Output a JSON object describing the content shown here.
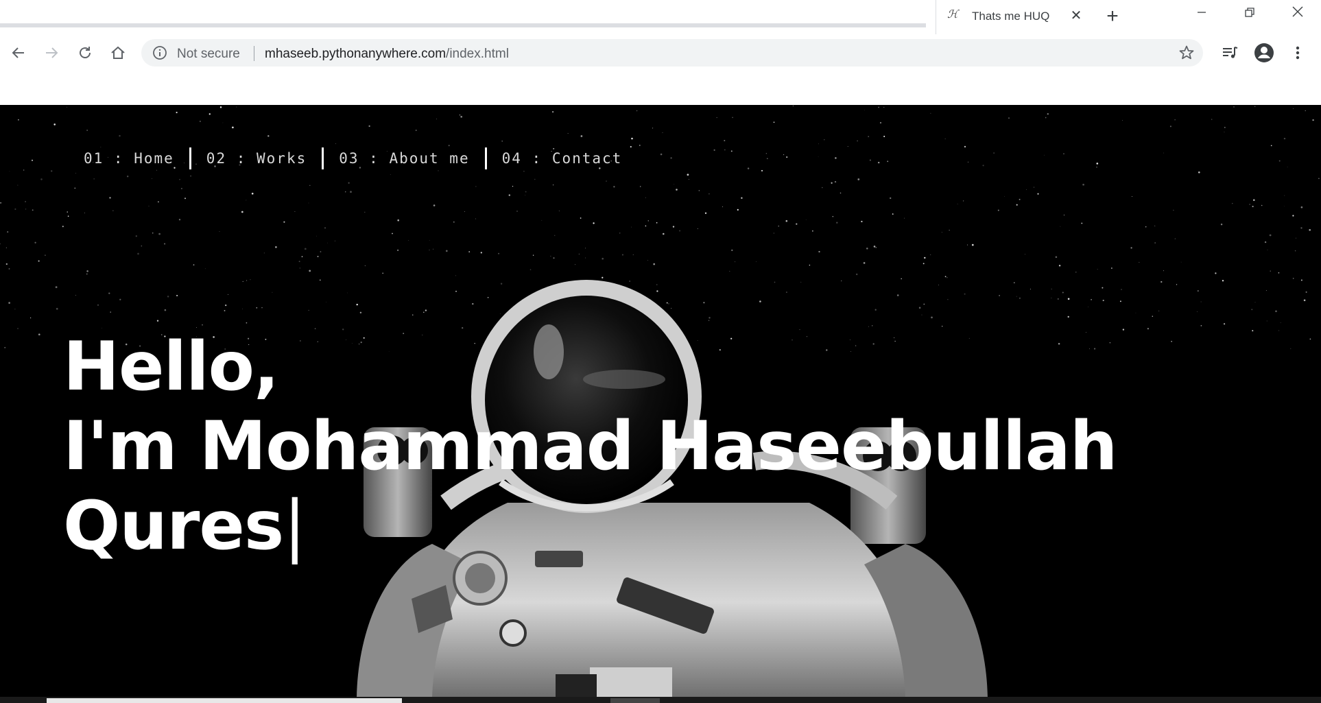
{
  "browser": {
    "tab": {
      "favicon_text": "ℋ",
      "title": "Thats me HUQ",
      "close": "✕"
    },
    "new_tab": "+",
    "window_controls": {
      "minimize": "—",
      "restore": "❐",
      "close": "✕"
    },
    "address_bar": {
      "security_label": "Not secure",
      "url_host": "mhaseeb.pythonanywhere.com",
      "url_path": "/index.html"
    }
  },
  "page": {
    "nav": [
      {
        "label": "01 : Home"
      },
      {
        "label": "02 : Works"
      },
      {
        "label": "03 : About me"
      },
      {
        "label": "04 : Contact"
      }
    ],
    "headline": {
      "line1": "Hello,",
      "line2": "I'm Mohammad Haseebullah",
      "line3": "Qures",
      "caret": "|"
    }
  },
  "colors": {
    "hero_background": "#000000",
    "headline_text": "#ffffff",
    "nav_text": "#d9d9d9"
  }
}
